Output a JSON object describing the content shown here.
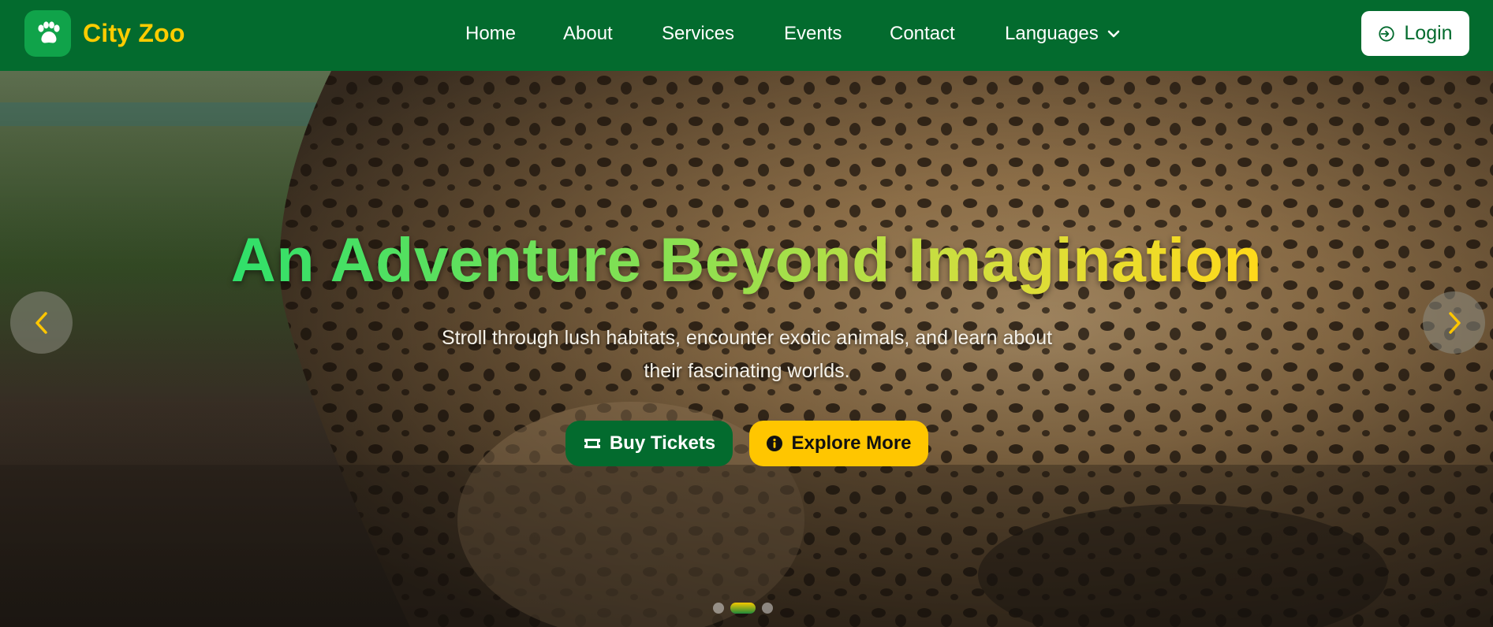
{
  "brand": {
    "name": "City Zoo",
    "logo_icon": "paw-icon"
  },
  "nav": {
    "items": [
      {
        "label": "Home"
      },
      {
        "label": "About"
      },
      {
        "label": "Services"
      },
      {
        "label": "Events"
      },
      {
        "label": "Contact"
      },
      {
        "label": "Languages",
        "icon": "chevron-down-icon"
      }
    ]
  },
  "login": {
    "label": "Login",
    "icon": "login-icon"
  },
  "hero": {
    "title": "An Adventure Beyond Imagination",
    "subtitle": "Stroll through lush habitats, encounter exotic animals, and learn about their fascinating worlds.",
    "primary_button": {
      "label": "Buy Tickets",
      "icon": "ticket-icon"
    },
    "secondary_button": {
      "label": "Explore More",
      "icon": "info-icon"
    },
    "prev_icon": "chevron-left-icon",
    "next_icon": "chevron-right-icon",
    "slide_count": 3,
    "active_slide": 2
  },
  "colors": {
    "navbar": "#036b2e",
    "brand_text": "#ffcc00",
    "primary_button": "#036b2e",
    "secondary_button": "#ffc600",
    "arrow_icon": "#ffc600",
    "title_gradient_start": "#2fe06a",
    "title_gradient_end": "#ffd91a"
  }
}
